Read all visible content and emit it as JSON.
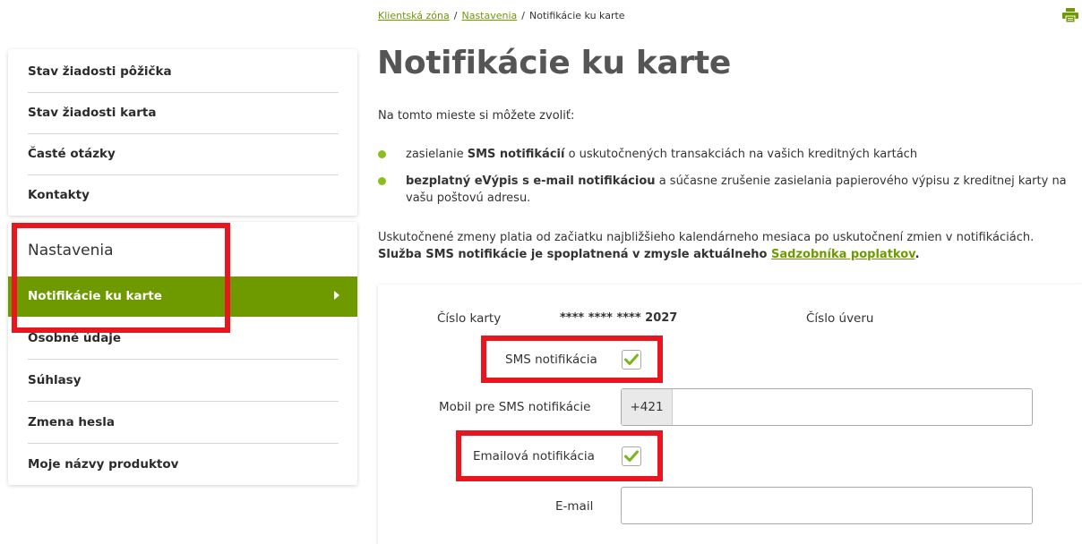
{
  "breadcrumb": {
    "items": [
      "Klientská zóna",
      "Nastavenia"
    ],
    "separator": "/",
    "current": "Notifikácie ku karte"
  },
  "sidebar": {
    "top_items": [
      {
        "label": "Stav žiadosti pôžička"
      },
      {
        "label": "Stav žiadosti karta"
      },
      {
        "label": "Časté otázky"
      },
      {
        "label": "Kontakty"
      }
    ],
    "section_heading": "Nastavenia",
    "active_item": "Notifikácie ku karte",
    "section_items": [
      {
        "label": "Osobné údaje"
      },
      {
        "label": "Súhlasy"
      },
      {
        "label": "Zmena hesla"
      },
      {
        "label": "Moje názvy produktov"
      }
    ]
  },
  "main": {
    "title": "Notifikácie ku karte",
    "intro": "Na tomto mieste si môžete zvoliť:",
    "bullet1": {
      "pre": "zasielanie ",
      "bold": "SMS notifikácií",
      "post": " o uskutočnených transakciách na vašich kreditných kartách"
    },
    "bullet2": {
      "bold": "bezplatný eVýpis s e-mail notifikáciou",
      "post": " a súčasne zrušenie zasielania papierového výpisu z kreditnej karty na vašu poštovú adresu."
    },
    "note_line1": "Uskutočnené zmeny platia od začiatku najbližšieho kalendárneho mesiaca po uskutočnení zmien v notifikáciách.",
    "note_bold": "Služba SMS notifikácie je spoplatnená v zmysle aktuálneho ",
    "note_link": "Sadzobníka poplatkov",
    "note_end": "."
  },
  "form": {
    "card_label": "Číslo karty",
    "card_value": "**** **** **** 2027",
    "loan_label": "Číslo úveru",
    "sms_label": "SMS notifikácia",
    "sms_checked": true,
    "mobile_label": "Mobil pre SMS notifikácie",
    "mobile_prefix": "+421",
    "mobile_value": "",
    "email_notif_label": "Emailová notifikácia",
    "email_checked": true,
    "email_label": "E-mail",
    "email_value": ""
  },
  "colors": {
    "brand_green": "#6e9a00",
    "bullet_green": "#8cbd1f",
    "highlight_red": "#e8161f",
    "check_green": "#7ab51d"
  },
  "icons": {
    "print": "printer-icon",
    "arrow": "chevron-right-icon",
    "check": "checkmark-icon"
  }
}
